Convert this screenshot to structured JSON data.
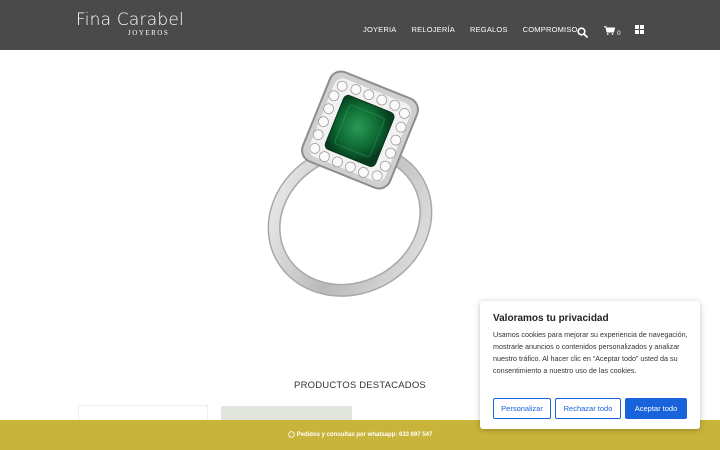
{
  "header": {
    "logo_main": "Fina Carabel",
    "logo_sub": "JOYEROS",
    "nav": [
      "JOYERIA",
      "RELOJERÍA",
      "REGALOS",
      "COMPROMISO"
    ],
    "cart_count": "0",
    "icons": [
      "search-icon",
      "cart-icon",
      "grid-menu-icon"
    ]
  },
  "hero": {
    "image": "emerald-diamond-halo-ring"
  },
  "main": {
    "section_title": "PRODUCTOS DESTACADOS"
  },
  "whatsapp_bar": {
    "text": "Pedidos y consultas por whatsapp: 633 697 547",
    "icon": "whatsapp-icon",
    "color": "#c8b43a"
  },
  "cookie": {
    "title": "Valoramos tu privacidad",
    "text": "Usamos cookies para mejorar su experiencia de navegación, mostrarle anuncios o contenidos personalizados y analizar nuestro tráfico. Al hacer clic en “Aceptar todo” usted da su consentimiento a nuestro uso de las cookies.",
    "buttons": {
      "customize": "Personalizar",
      "reject": "Rechazar todo",
      "accept": "Aceptar todo"
    },
    "accent": "#1863dc"
  }
}
